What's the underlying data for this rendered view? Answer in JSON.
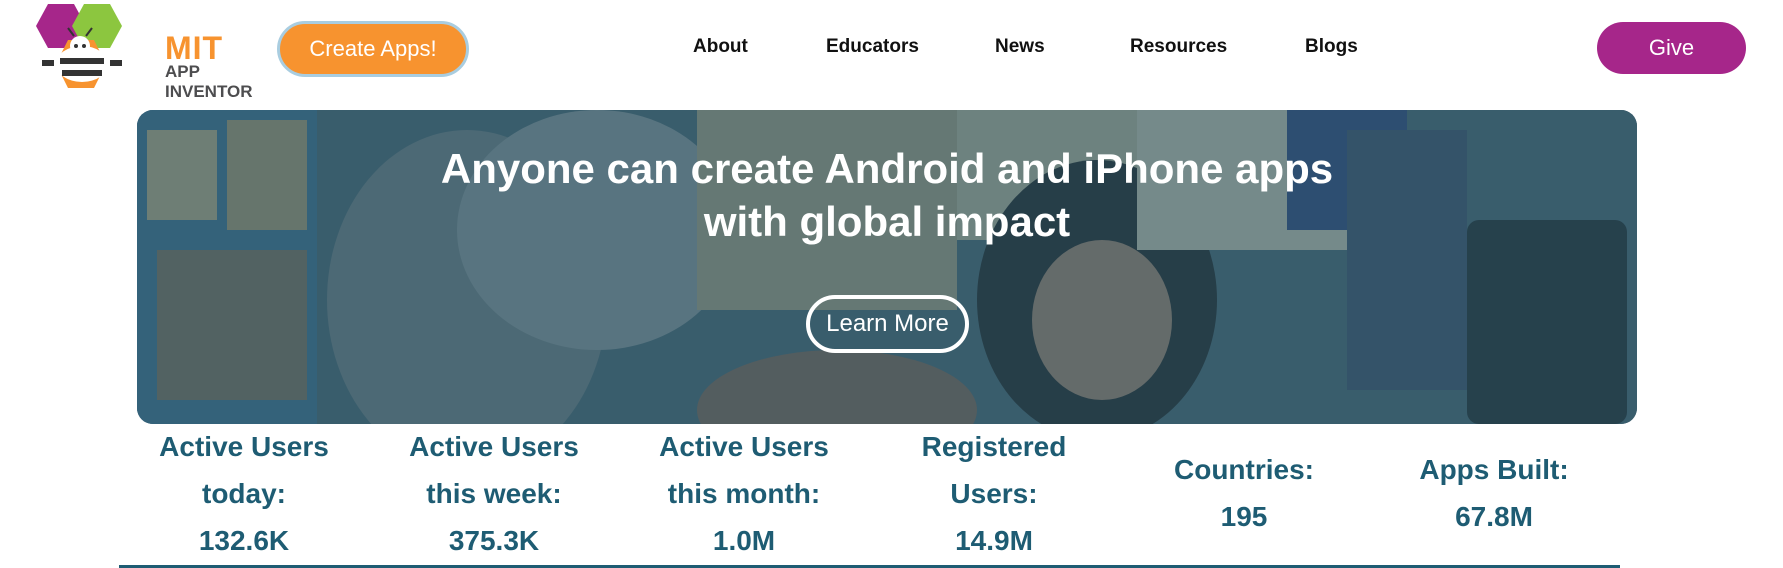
{
  "header": {
    "logo": {
      "title": "MIT",
      "subtitle": "APP INVENTOR"
    },
    "create_button": "Create Apps!",
    "nav": [
      "About",
      "Educators",
      "News",
      "Resources",
      "Blogs"
    ],
    "give_button": "Give"
  },
  "hero": {
    "title_line1": "Anyone can create Android and iPhone apps",
    "title_line2": "with global impact",
    "button": "Learn More"
  },
  "stats": [
    {
      "label_line1": "Active Users",
      "label_line2": "today:",
      "value": "132.6K"
    },
    {
      "label_line1": "Active Users",
      "label_line2": "this week:",
      "value": "375.3K"
    },
    {
      "label_line1": "Active Users",
      "label_line2": "this month:",
      "value": "1.0M"
    },
    {
      "label_line1": "Registered",
      "label_line2": "Users:",
      "value": "14.9M"
    },
    {
      "label_line1": "Countries:",
      "value": "195"
    },
    {
      "label_line1": "Apps Built:",
      "value": "67.8M"
    }
  ],
  "colors": {
    "orange": "#f7932f",
    "purple": "#a6268a",
    "teal": "#1e5c73"
  }
}
